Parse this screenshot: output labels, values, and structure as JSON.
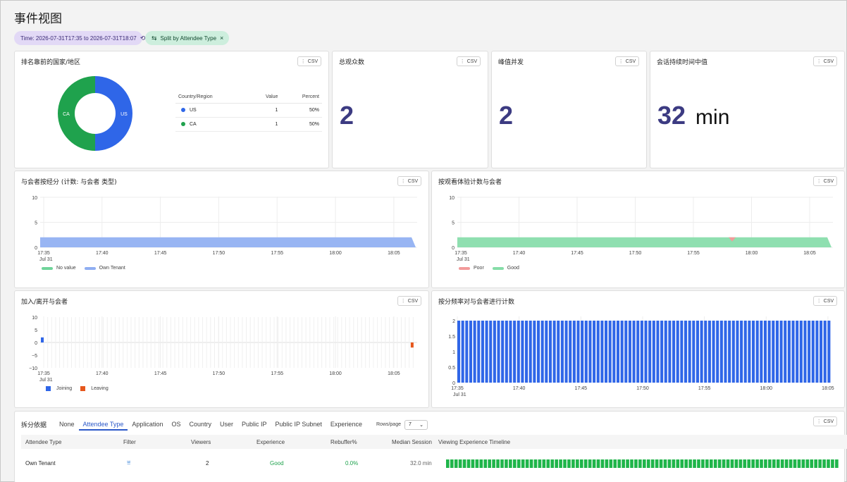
{
  "page": {
    "title": "事件视图"
  },
  "filters": {
    "time_label": "Time: 2026-07-31T17:35 to 2026-07-31T18:07",
    "split_label": "Split by Attendee Type"
  },
  "csv_label": "CSV",
  "cards": {
    "top_countries": {
      "title": "排名靠前的国家/地区",
      "columns": [
        "Country/Region",
        "Value",
        "Percent"
      ],
      "rows": [
        {
          "name": "US",
          "value": "1",
          "percent": "50%",
          "color": "#2f66e8"
        },
        {
          "name": "CA",
          "value": "1",
          "percent": "50%",
          "color": "#1fa24d"
        }
      ]
    },
    "total_viewers": {
      "title": "总观众数",
      "value": "2"
    },
    "peak_concurrent": {
      "title": "峰值并发",
      "value": "2"
    },
    "median_session": {
      "title": "会话持续时间中值",
      "value": "32",
      "unit": "min"
    },
    "attendees_by_type": {
      "title": "与会者按经分 (计数: 与会者 类型)",
      "legend": [
        {
          "name": "No value",
          "color": "#6fd49a"
        },
        {
          "name": "Own Tenant",
          "color": "#8faef2"
        }
      ]
    },
    "attendees_by_experience": {
      "title": "按观看体验计数与会者",
      "legend": [
        {
          "name": "Poor",
          "color": "#f29a9a"
        },
        {
          "name": "Good",
          "color": "#86dda8"
        }
      ]
    },
    "join_leave": {
      "title": "加入/离开与会者",
      "legend": [
        {
          "name": "Joining",
          "color": "#2f66e8"
        },
        {
          "name": "Leaving",
          "color": "#e6571c"
        }
      ]
    },
    "attendees_by_frequency": {
      "title": "按分频率对与会者进行计数"
    }
  },
  "chart_data": [
    {
      "type": "pie",
      "categories": [
        "US",
        "CA"
      ],
      "values": [
        1,
        1
      ],
      "colors": [
        "#2f66e8",
        "#1fa24d"
      ]
    },
    {
      "type": "area",
      "x": [
        "17:35",
        "17:40",
        "17:45",
        "17:50",
        "17:55",
        "18:00",
        "18:05"
      ],
      "x_sublabel": "Jul 31",
      "y_ticks": [
        "10",
        "5",
        "0"
      ],
      "ylim": [
        0,
        10
      ],
      "series": [
        {
          "name": "No value",
          "values": [
            0,
            0,
            0,
            0,
            0,
            0,
            0
          ]
        },
        {
          "name": "Own Tenant",
          "values": [
            2,
            2,
            2,
            2,
            2,
            2,
            2
          ]
        }
      ]
    },
    {
      "type": "area",
      "x": [
        "17:35",
        "17:40",
        "17:45",
        "17:50",
        "17:55",
        "18:00",
        "18:05"
      ],
      "x_sublabel": "Jul 31",
      "y_ticks": [
        "10",
        "5",
        "0"
      ],
      "ylim": [
        0,
        10
      ],
      "series": [
        {
          "name": "Poor",
          "values": [
            0,
            0,
            0,
            0,
            0,
            0,
            0
          ]
        },
        {
          "name": "Good",
          "values": [
            2,
            2,
            2,
            2,
            2,
            2,
            2
          ]
        }
      ]
    },
    {
      "type": "bar",
      "x": [
        "17:35",
        "17:40",
        "17:45",
        "17:50",
        "17:55",
        "18:00",
        "18:05"
      ],
      "x_sublabel": "Jul 31",
      "y_ticks": [
        "10",
        "5",
        "0",
        "−5",
        "−10"
      ],
      "ylim": [
        -10,
        10
      ],
      "series": [
        {
          "name": "Joining",
          "values": [
            2
          ]
        },
        {
          "name": "Leaving",
          "values": [
            -2
          ]
        }
      ]
    },
    {
      "type": "bar",
      "x": [
        "17:35",
        "17:40",
        "17:45",
        "17:50",
        "17:55",
        "18:00",
        "18:05"
      ],
      "x_sublabel": "Jul 31",
      "y_ticks": [
        "2",
        "1.5",
        "1",
        "0.5",
        "0"
      ],
      "ylim": [
        0,
        2
      ],
      "bar_count": 94,
      "bar_value": 2
    }
  ],
  "split": {
    "label": "拆分依据",
    "tabs": [
      "None",
      "Attendee Type",
      "Application",
      "OS",
      "Country",
      "User",
      "Public IP",
      "Public IP Subnet",
      "Experience"
    ],
    "active_tab": "Attendee Type",
    "rows_per_page_label": "Rows/page",
    "rows_per_page_value": "7",
    "table": {
      "columns": [
        "Attendee Type",
        "Filter",
        "Viewers",
        "Experience",
        "Rebuffer%",
        "Median Session",
        "Viewing Experience Timeline"
      ],
      "rows": [
        {
          "attendee_type": "Own Tenant",
          "viewers": "2",
          "experience": "Good",
          "rebuffer": "0.0%",
          "median_session": "32.0 min"
        }
      ]
    }
  },
  "colors": {
    "accent": "#2b58c8",
    "good": "#1fa24d",
    "big_number": "#3c3b82"
  }
}
